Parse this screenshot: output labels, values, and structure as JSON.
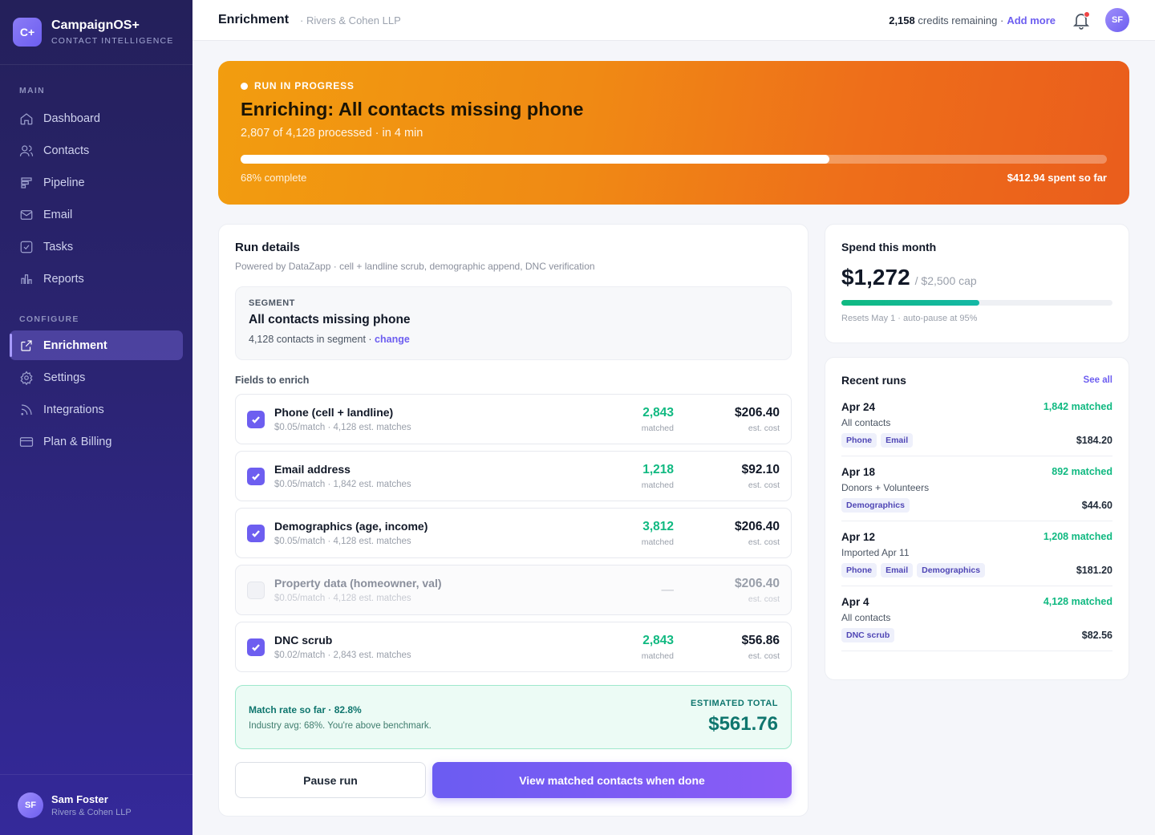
{
  "brand": {
    "initials": "C+",
    "name": "CampaignOS+",
    "tagline": "CONTACT INTELLIGENCE"
  },
  "nav": {
    "main_label": "MAIN",
    "main_items": [
      {
        "label": "Dashboard",
        "icon": "home-icon"
      },
      {
        "label": "Contacts",
        "icon": "users-icon"
      },
      {
        "label": "Pipeline",
        "icon": "pipeline-icon"
      },
      {
        "label": "Email",
        "icon": "mail-icon"
      },
      {
        "label": "Tasks",
        "icon": "checkbox-icon"
      },
      {
        "label": "Reports",
        "icon": "bar-chart-icon"
      }
    ],
    "configure_label": "CONFIGURE",
    "configure_items": [
      {
        "label": "Enrichment",
        "icon": "export-icon",
        "active": true
      },
      {
        "label": "Settings",
        "icon": "gear-icon"
      },
      {
        "label": "Integrations",
        "icon": "rss-icon"
      },
      {
        "label": "Plan & Billing",
        "icon": "credit-card-icon"
      }
    ]
  },
  "user": {
    "initials": "SF",
    "name": "Sam Foster",
    "org": "Rivers & Cohen LLP"
  },
  "topbar": {
    "title": "Enrichment",
    "crumb": "· Rivers & Cohen LLP",
    "credits_count": "2,158",
    "credits_text": "credits remaining ·",
    "add_more": "Add more",
    "avatar": "SF"
  },
  "banner": {
    "status": "RUN IN PROGRESS",
    "title": "Enriching: All contacts missing phone",
    "subtitle": "2,807 of 4,128 processed · in 4 min",
    "progress": 0.68,
    "progress_label": "68% complete",
    "spent": "$412.94 spent so far"
  },
  "details": {
    "title": "Run details",
    "subtitle": "Powered by DataZapp · cell + landline scrub, demographic append, DNC verification",
    "segment_label": "SEGMENT",
    "segment_name": "All contacts missing phone",
    "segment_count": "4,128 contacts in segment ·",
    "segment_change": "change",
    "fields_label": "Fields to enrich",
    "fields": [
      {
        "name": "Phone (cell + landline)",
        "meta": "$0.05/match · 4,128 est. matches",
        "matched": "2,843",
        "matched_label": "matched",
        "cost": "$206.40",
        "cost_label": "est. cost",
        "checked": true
      },
      {
        "name": "Email address",
        "meta": "$0.05/match · 1,842 est. matches",
        "matched": "1,218",
        "matched_label": "matched",
        "cost": "$92.10",
        "cost_label": "est. cost",
        "checked": true
      },
      {
        "name": "Demographics (age, income)",
        "meta": "$0.05/match · 4,128 est. matches",
        "matched": "3,812",
        "matched_label": "matched",
        "cost": "$206.40",
        "cost_label": "est. cost",
        "checked": true
      },
      {
        "name": "Property data (homeowner, val)",
        "meta": "$0.05/match · 4,128 est. matches",
        "matched": "—",
        "matched_label": "",
        "cost": "$206.40",
        "cost_label": "est. cost",
        "checked": false
      },
      {
        "name": "DNC scrub",
        "meta": "$0.02/match · 2,843 est. matches",
        "matched": "2,843",
        "matched_label": "matched",
        "cost": "$56.86",
        "cost_label": "est. cost",
        "checked": true
      }
    ],
    "match_rate": "Match rate so far · 82.8%",
    "match_note": "Industry avg: 68%. You're above benchmark.",
    "est_label": "ESTIMATED TOTAL",
    "est_total": "$561.76",
    "pause_label": "Pause run",
    "view_label": "View matched contacts when done"
  },
  "spend": {
    "title": "Spend this month",
    "amount": "$1,272",
    "cap": "/ $2,500 cap",
    "fraction": 0.509,
    "note": "Resets May 1 · auto-pause at 95%"
  },
  "recent": {
    "title": "Recent runs",
    "see_all": "See all",
    "runs": [
      {
        "date": "Apr 24",
        "matched": "1,842 matched",
        "segment": "All contacts",
        "tags": [
          "Phone",
          "Email"
        ],
        "cost": "$184.20"
      },
      {
        "date": "Apr 18",
        "matched": "892 matched",
        "segment": "Donors + Volunteers",
        "tags": [
          "Demographics"
        ],
        "cost": "$44.60"
      },
      {
        "date": "Apr 12",
        "matched": "1,208 matched",
        "segment": "Imported Apr 11",
        "tags": [
          "Phone",
          "Email",
          "Demographics"
        ],
        "cost": "$181.20"
      },
      {
        "date": "Apr 4",
        "matched": "4,128 matched",
        "segment": "All contacts",
        "tags": [
          "DNC scrub"
        ],
        "cost": "$82.56"
      }
    ]
  },
  "colors": {
    "accent": "#6d5ef0",
    "success": "#10b981",
    "banner_start": "#f29d0f",
    "banner_end": "#ea5d1c"
  }
}
